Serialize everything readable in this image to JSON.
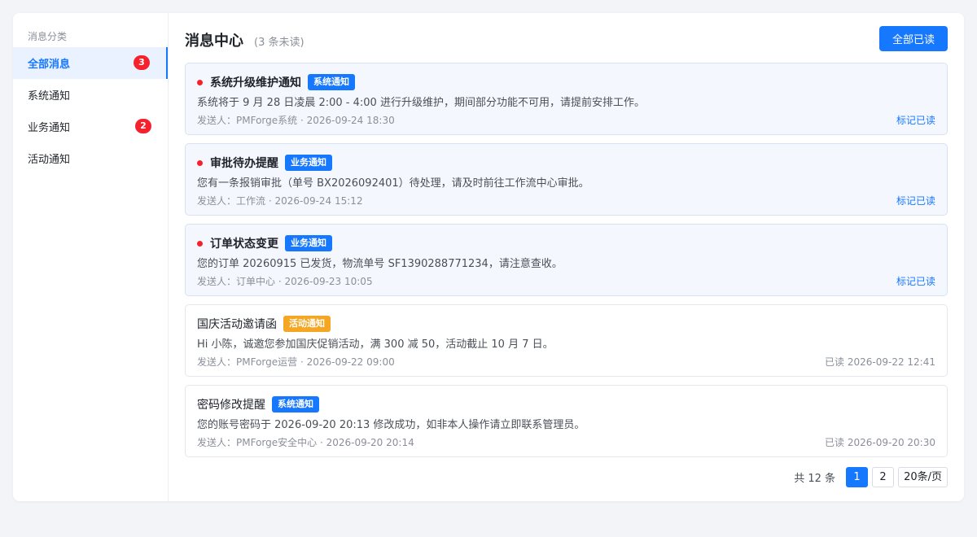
{
  "sidebar": {
    "heading": "消息分类",
    "items": [
      {
        "label": "全部消息",
        "badge": "3",
        "active": true
      },
      {
        "label": "系统通知",
        "badge": ""
      },
      {
        "label": "业务通知",
        "badge": "2"
      },
      {
        "label": "活动通知",
        "badge": ""
      }
    ]
  },
  "header": {
    "title": "消息中心",
    "unread_hint": "(3 条未读)",
    "mark_all_label": "全部已读"
  },
  "messages": [
    {
      "title": "系统升级维护通知",
      "tag": "系统通知",
      "tag_color": "#1677ff",
      "unread": true,
      "body": "系统将于 9 月 28 日凌晨 2:00 - 4:00 进行升级维护，期间部分功能不可用，请提前安排工作。",
      "meta": "发送人：PMForge系统 · 2026-09-24 18:30",
      "action": "标记已读"
    },
    {
      "title": "审批待办提醒",
      "tag": "业务通知",
      "tag_color": "#1677ff",
      "unread": true,
      "body": "您有一条报销审批（单号 BX2026092401）待处理，请及时前往工作流中心审批。",
      "meta": "发送人：工作流 · 2026-09-24 15:12",
      "action": "标记已读"
    },
    {
      "title": "订单状态变更",
      "tag": "业务通知",
      "tag_color": "#1677ff",
      "unread": true,
      "body": "您的订单 20260915 已发货，物流单号 SF1390288771234，请注意查收。",
      "meta": "发送人：订单中心 · 2026-09-23 10:05",
      "action": "标记已读"
    },
    {
      "title": "国庆活动邀请函",
      "tag": "活动通知",
      "tag_color": "#f5a623",
      "unread": false,
      "body": "Hi 小陈，诚邀您参加国庆促销活动，满 300 减 50，活动截止 10 月 7 日。",
      "meta": "发送人：PMForge运营 · 2026-09-22 09:00",
      "read_status": "已读 2026-09-22 12:41"
    },
    {
      "title": "密码修改提醒",
      "tag": "系统通知",
      "tag_color": "#1677ff",
      "unread": false,
      "body": "您的账号密码于 2026-09-20 20:13 修改成功，如非本人操作请立即联系管理员。",
      "meta": "发送人：PMForge安全中心 · 2026-09-20 20:14",
      "read_status": "已读 2026-09-20 20:30"
    }
  ],
  "pagination": {
    "total_label": "共 12 条",
    "pages": [
      "1",
      "2"
    ],
    "current_page": "1",
    "page_size_label": "20条/页"
  }
}
